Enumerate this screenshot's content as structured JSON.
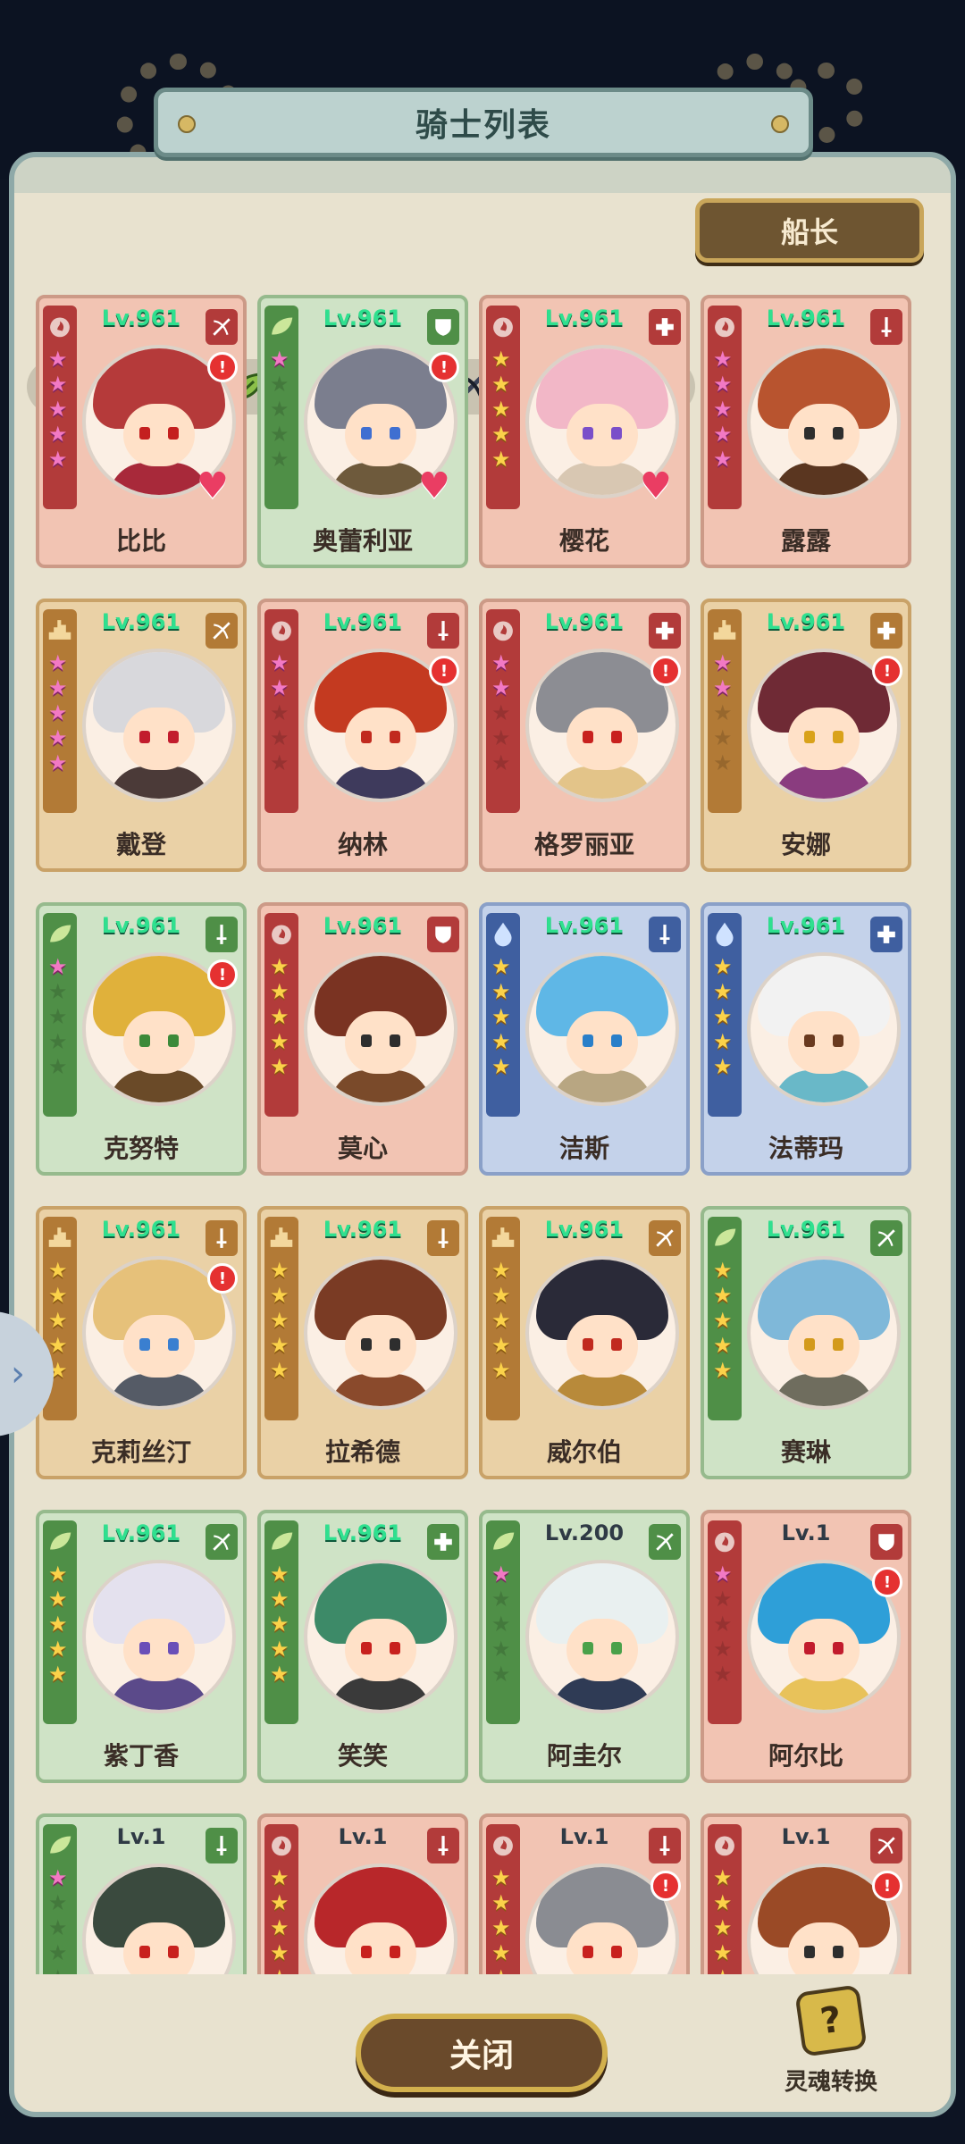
{
  "header": {
    "title": "骑士列表"
  },
  "filters": {
    "elements": [
      "fire-icon",
      "water-icon",
      "earth-icon",
      "nature-icon"
    ],
    "classes": [
      "shield-icon",
      "sword-icon",
      "bow-icon",
      "cross-icon"
    ]
  },
  "captain_button": {
    "label": "船长"
  },
  "colors": {
    "fire": "#b23b3a",
    "nature": "#4f8f47",
    "water": "#3f5fa0",
    "earth": "#b27a36",
    "level_green": "#2fe08f"
  },
  "heroes": [
    {
      "name": "比比",
      "level": "Lv.961",
      "element": "fire",
      "class_icon": "bow",
      "stars": 5,
      "star_color": "pink",
      "alert": true,
      "heart": true,
      "hair": "#b53a3a",
      "eyes": "#c41f1f",
      "outfit": "#a8293a"
    },
    {
      "name": "奥蕾利亚",
      "level": "Lv.961",
      "element": "nature",
      "class_icon": "shield",
      "stars": 1,
      "star_color": "pink",
      "alert": true,
      "heart": true,
      "hair": "#7b7e8e",
      "eyes": "#3f6fd1",
      "outfit": "#6e5a3c"
    },
    {
      "name": "樱花",
      "level": "Lv.961",
      "element": "fire",
      "class_icon": "cross",
      "stars": 5,
      "star_color": "gold",
      "alert": false,
      "heart": true,
      "hair": "#f2b7c7",
      "eyes": "#7a4fc9",
      "outfit": "#d8c7b2"
    },
    {
      "name": "露露",
      "level": "Lv.961",
      "element": "fire",
      "class_icon": "sword",
      "stars": 5,
      "star_color": "pink",
      "alert": false,
      "heart": false,
      "hair": "#b8542f",
      "eyes": "#2e2e2e",
      "outfit": "#5a3620"
    },
    {
      "name": "戴登",
      "level": "Lv.961",
      "element": "earth",
      "class_icon": "bow",
      "stars": 5,
      "star_color": "pink",
      "alert": false,
      "heart": false,
      "hair": "#d8d8dc",
      "eyes": "#c21c2d",
      "outfit": "#4b3a38"
    },
    {
      "name": "纳林",
      "level": "Lv.961",
      "element": "fire",
      "class_icon": "sword",
      "stars": 2,
      "star_color": "pink",
      "alert": true,
      "heart": false,
      "hair": "#c43a20",
      "eyes": "#c12a1f",
      "outfit": "#3e3a5c"
    },
    {
      "name": "格罗丽亚",
      "level": "Lv.961",
      "element": "fire",
      "class_icon": "cross",
      "stars": 2,
      "star_color": "pink",
      "alert": true,
      "heart": false,
      "hair": "#8c8d93",
      "eyes": "#c8211e",
      "outfit": "#e3c489"
    },
    {
      "name": "安娜",
      "level": "Lv.961",
      "element": "earth",
      "class_icon": "cross",
      "stars": 2,
      "star_color": "pink",
      "alert": true,
      "heart": false,
      "hair": "#6f2a35",
      "eyes": "#d9a21a",
      "outfit": "#8a3c7f"
    },
    {
      "name": "克努特",
      "level": "Lv.961",
      "element": "nature",
      "class_icon": "sword",
      "stars": 1,
      "star_color": "pink",
      "alert": true,
      "heart": false,
      "hair": "#e0b13b",
      "eyes": "#3c8a3a",
      "outfit": "#6a4a28"
    },
    {
      "name": "莫心",
      "level": "Lv.961",
      "element": "fire",
      "class_icon": "shield",
      "stars": 5,
      "star_color": "gold",
      "alert": false,
      "heart": false,
      "hair": "#7a3322",
      "eyes": "#2e2e2e",
      "outfit": "#7a4a2a"
    },
    {
      "name": "洁斯",
      "level": "Lv.961",
      "element": "water",
      "class_icon": "sword",
      "stars": 5,
      "star_color": "gold",
      "alert": false,
      "heart": false,
      "hair": "#5fb7e6",
      "eyes": "#2a7fc9",
      "outfit": "#b8a682"
    },
    {
      "name": "法蒂玛",
      "level": "Lv.961",
      "element": "water",
      "class_icon": "cross",
      "stars": 5,
      "star_color": "gold",
      "alert": false,
      "heart": false,
      "hair": "#f2f2f2",
      "eyes": "#6a3a1f",
      "outfit": "#69b8c8"
    },
    {
      "name": "克莉丝汀",
      "level": "Lv.961",
      "element": "earth",
      "class_icon": "sword",
      "stars": 5,
      "star_color": "gold",
      "alert": true,
      "heart": false,
      "hair": "#e6c17a",
      "eyes": "#3a7fd0",
      "outfit": "#555b66"
    },
    {
      "name": "拉希德",
      "level": "Lv.961",
      "element": "earth",
      "class_icon": "sword",
      "stars": 5,
      "star_color": "gold",
      "alert": false,
      "heart": false,
      "hair": "#7a3b24",
      "eyes": "#2e2e2e",
      "outfit": "#8a4a2c"
    },
    {
      "name": "威尔伯",
      "level": "Lv.961",
      "element": "earth",
      "class_icon": "bow",
      "stars": 5,
      "star_color": "gold",
      "alert": false,
      "heart": false,
      "hair": "#2a2a38",
      "eyes": "#c12a1f",
      "outfit": "#b88a3a"
    },
    {
      "name": "赛琳",
      "level": "Lv.961",
      "element": "nature",
      "class_icon": "bow",
      "stars": 5,
      "star_color": "gold",
      "alert": false,
      "heart": false,
      "hair": "#7fb8d9",
      "eyes": "#d39a1c",
      "outfit": "#6f6d5e"
    },
    {
      "name": "紫丁香",
      "level": "Lv.961",
      "element": "nature",
      "class_icon": "bow",
      "stars": 5,
      "star_color": "gold",
      "alert": false,
      "heart": false,
      "hair": "#e4e1ee",
      "eyes": "#6a4fb8",
      "outfit": "#5b4a8a"
    },
    {
      "name": "笑笑",
      "level": "Lv.961",
      "element": "nature",
      "class_icon": "cross",
      "stars": 5,
      "star_color": "gold",
      "alert": false,
      "heart": false,
      "hair": "#3d8a68",
      "eyes": "#c8211e",
      "outfit": "#3a3a3a"
    },
    {
      "name": "阿圭尔",
      "level": "Lv.200",
      "element": "nature",
      "class_icon": "bow",
      "stars": 1,
      "star_color": "pink",
      "alert": false,
      "heart": false,
      "hair": "#e9f0f0",
      "eyes": "#4aa14a",
      "outfit": "#2f3b55"
    },
    {
      "name": "阿尔比",
      "level": "Lv.1",
      "element": "fire",
      "class_icon": "shield",
      "stars": 1,
      "star_color": "pink",
      "alert": true,
      "heart": false,
      "hair": "#2e9fd8",
      "eyes": "#c21c2d",
      "outfit": "#e8c25a"
    },
    {
      "name": "",
      "level": "Lv.1",
      "element": "nature",
      "class_icon": "sword",
      "stars": 1,
      "star_color": "pink",
      "alert": false,
      "heart": false,
      "hair": "#3a4a3e",
      "eyes": "#c8211e",
      "outfit": "#444"
    },
    {
      "name": "",
      "level": "Lv.1",
      "element": "fire",
      "class_icon": "sword",
      "stars": 5,
      "star_color": "gold",
      "alert": false,
      "heart": false,
      "hair": "#b8272a",
      "eyes": "#c8211e",
      "outfit": "#444"
    },
    {
      "name": "",
      "level": "Lv.1",
      "element": "fire",
      "class_icon": "sword",
      "stars": 5,
      "star_color": "gold",
      "alert": true,
      "heart": false,
      "hair": "#8a8c92",
      "eyes": "#c8211e",
      "outfit": "#444"
    },
    {
      "name": "",
      "level": "Lv.1",
      "element": "fire",
      "class_icon": "bow",
      "stars": 5,
      "star_color": "gold",
      "alert": true,
      "heart": false,
      "hair": "#9a4a26",
      "eyes": "#2e2e2e",
      "outfit": "#444"
    }
  ],
  "bottom": {
    "close_label": "关闭",
    "soul_label": "灵魂转换",
    "soul_glyph": "?"
  },
  "nav": {
    "side_arrow": "›"
  }
}
